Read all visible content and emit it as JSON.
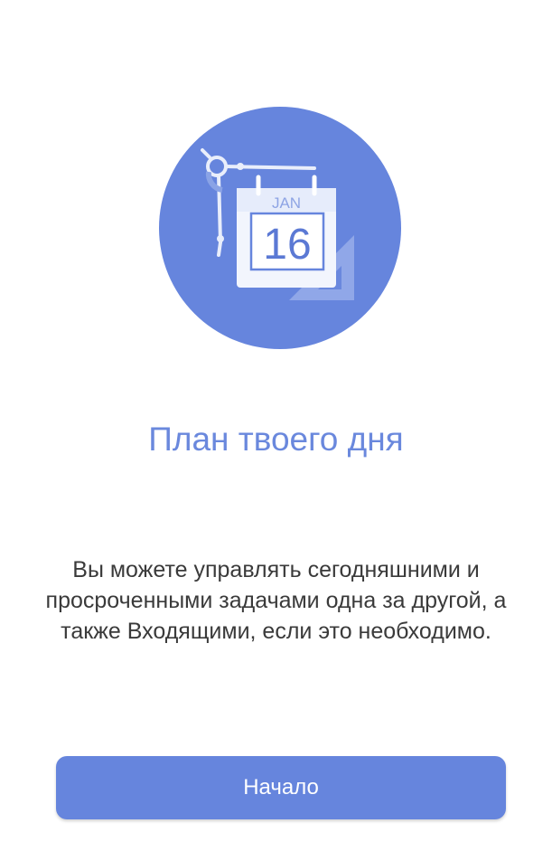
{
  "onboarding": {
    "illustration": {
      "icon": "calendar-with-compass-icon",
      "month_label": "JAN",
      "day_number": "16",
      "circle_color": "#6685dd"
    },
    "title": "План твоего дня",
    "description": "Вы можете управлять сегодняшними и просроченными задачами одна за другой, а также Входящими, если это необходимо.",
    "start_button_label": "Начало"
  },
  "colors": {
    "accent": "#6685dd",
    "title_text": "#6a88dd",
    "body_text": "#3a3a3a",
    "background": "#ffffff"
  }
}
